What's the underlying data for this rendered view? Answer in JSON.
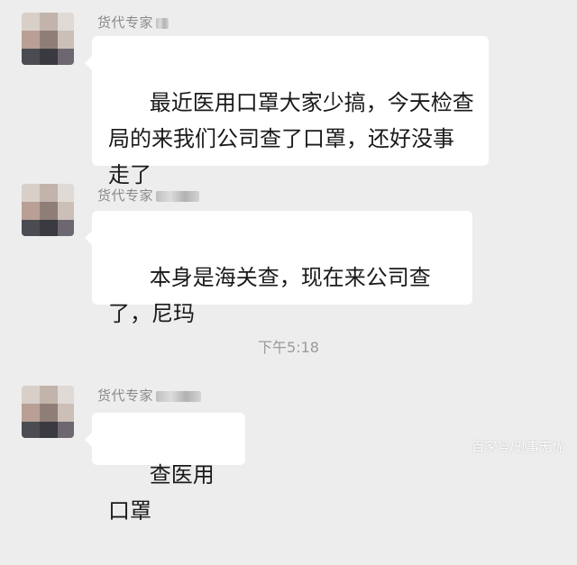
{
  "messages": [
    {
      "sender": "货代专家",
      "text": "最近医用口罩大家少搞，今天检查局的来我们公司查了口罩，还好没事走了"
    },
    {
      "sender": "货代专家",
      "text": "本身是海关查，现在来公司查了，尼玛"
    },
    {
      "sender": "货代专家",
      "text": "查医用口罩"
    }
  ],
  "timestamp": "下午5:18",
  "watermark": "百家号/逊事无忧",
  "colors": {
    "background": "#ededed",
    "bubble": "#ffffff",
    "sender_name": "#8a8a8a",
    "timestamp": "#9a9a9a"
  }
}
